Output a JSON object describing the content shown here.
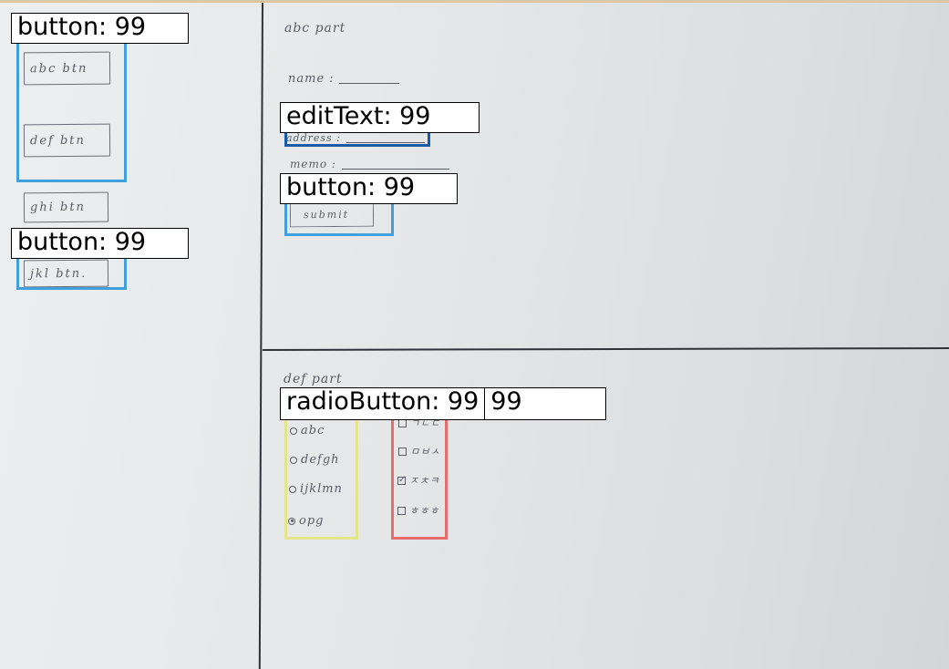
{
  "left_panel": {
    "buttons": [
      "abc btn",
      "def btn",
      "ghi btn",
      "jkl btn."
    ]
  },
  "abc_part": {
    "title": "abc part",
    "name_label": "name :",
    "address_label": "address :",
    "memo_label": "memo :",
    "submit_label": "submit"
  },
  "def_part": {
    "title": "def part",
    "radios": [
      {
        "label": "abc",
        "checked": false
      },
      {
        "label": "defgh",
        "checked": false
      },
      {
        "label": "ijklmn",
        "checked": false
      },
      {
        "label": "opg",
        "checked": true
      }
    ],
    "checkboxes": [
      {
        "label": "ㄱㄴㄷ",
        "checked": false
      },
      {
        "label": "ㅁㅂㅅ",
        "checked": false
      },
      {
        "label": "ㅈㅊㅋ",
        "checked": true
      },
      {
        "label": "ㅎㅎㅎ",
        "checked": false
      }
    ]
  },
  "detections": {
    "left_group_top": "button: 99",
    "left_group_bottom": "button: 99",
    "address_field": "editText: 99",
    "submit": "button: 99",
    "radio_group": "radioButton: 99",
    "checkbox_group": "99"
  },
  "colors": {
    "button_box": "#3fa0dd",
    "edittext_box": "#1c5aa5",
    "radio_box": "#e4e68a",
    "checkbox_box": "#e86a6a"
  }
}
